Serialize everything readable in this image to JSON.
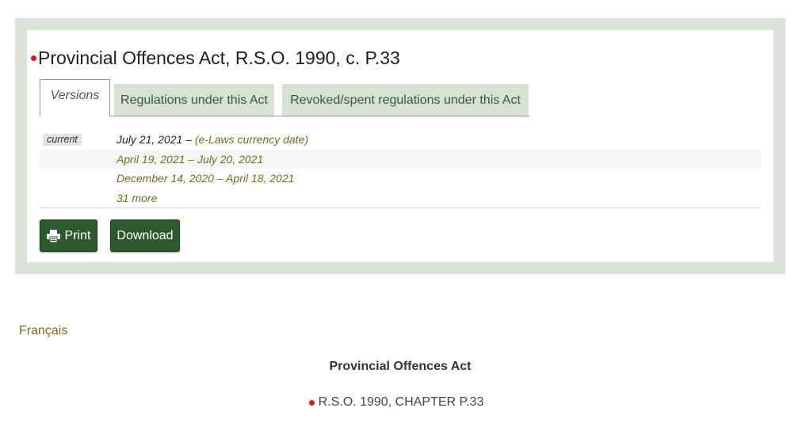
{
  "header": {
    "title": "Provincial Offences Act, R.S.O. 1990, c. P.33"
  },
  "tabs": [
    {
      "label": "Versions",
      "active": true
    },
    {
      "label": "Regulations under this Act",
      "active": false
    },
    {
      "label": "Revoked/spent regulations under this Act",
      "active": false
    }
  ],
  "versions": {
    "current_badge": "current",
    "current_date": "July 21, 2021 – ",
    "current_note": "(e-Laws currency date)",
    "items": [
      "April 19, 2021 – July 20, 2021",
      "December 14, 2020 – April 18, 2021"
    ],
    "more": "31 more"
  },
  "actions": {
    "print_label": "Print",
    "download_label": "Download"
  },
  "language_link": "Français",
  "act": {
    "title": "Provincial Offences Act",
    "citation": "R.S.O. 1990, CHAPTER P.33"
  },
  "colors": {
    "panel_bg": "#dbe3d9",
    "accent_green": "#2d5a2d",
    "link": "#7a6a1e",
    "marker": "#e0141b"
  }
}
